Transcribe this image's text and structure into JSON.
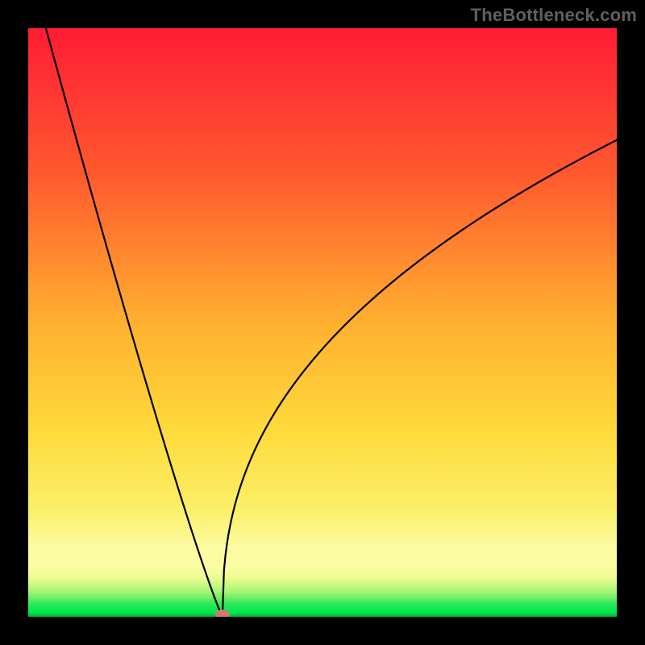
{
  "watermark": "TheBottleneck.com",
  "chart_data": {
    "type": "line",
    "title": "",
    "xlabel": "",
    "ylabel": "",
    "x_range": [
      0,
      100
    ],
    "y_range": [
      0,
      100
    ],
    "notch": {
      "x": 33,
      "y": 0
    },
    "curve_left": {
      "start_x": 3,
      "start_y": 100
    },
    "curve_right": {
      "end_x": 100,
      "end_y": 81
    },
    "marker": {
      "x": 33,
      "y": 0,
      "color": "#CF7A71"
    },
    "background_gradient": {
      "top_color": "#FF1C35",
      "mid_color": "#FFD93A",
      "band_pale": "#FCFCA3",
      "band_green": "#00E84B",
      "band_dark_green": "#00B33C"
    },
    "gradient_stops": [
      {
        "offset": 0.0,
        "color": "#FF1C35"
      },
      {
        "offset": 0.25,
        "color": "#FF5A2E"
      },
      {
        "offset": 0.5,
        "color": "#FFB030"
      },
      {
        "offset": 0.68,
        "color": "#FFD93A"
      },
      {
        "offset": 0.82,
        "color": "#FBF06A"
      },
      {
        "offset": 0.885,
        "color": "#FCFCA3"
      },
      {
        "offset": 0.918,
        "color": "#FCFCA3"
      },
      {
        "offset": 0.935,
        "color": "#E9FB8E"
      },
      {
        "offset": 0.958,
        "color": "#A3F574"
      },
      {
        "offset": 0.978,
        "color": "#2FE95A"
      },
      {
        "offset": 0.992,
        "color": "#00E84B"
      },
      {
        "offset": 1.0,
        "color": "#00B33C"
      }
    ]
  }
}
